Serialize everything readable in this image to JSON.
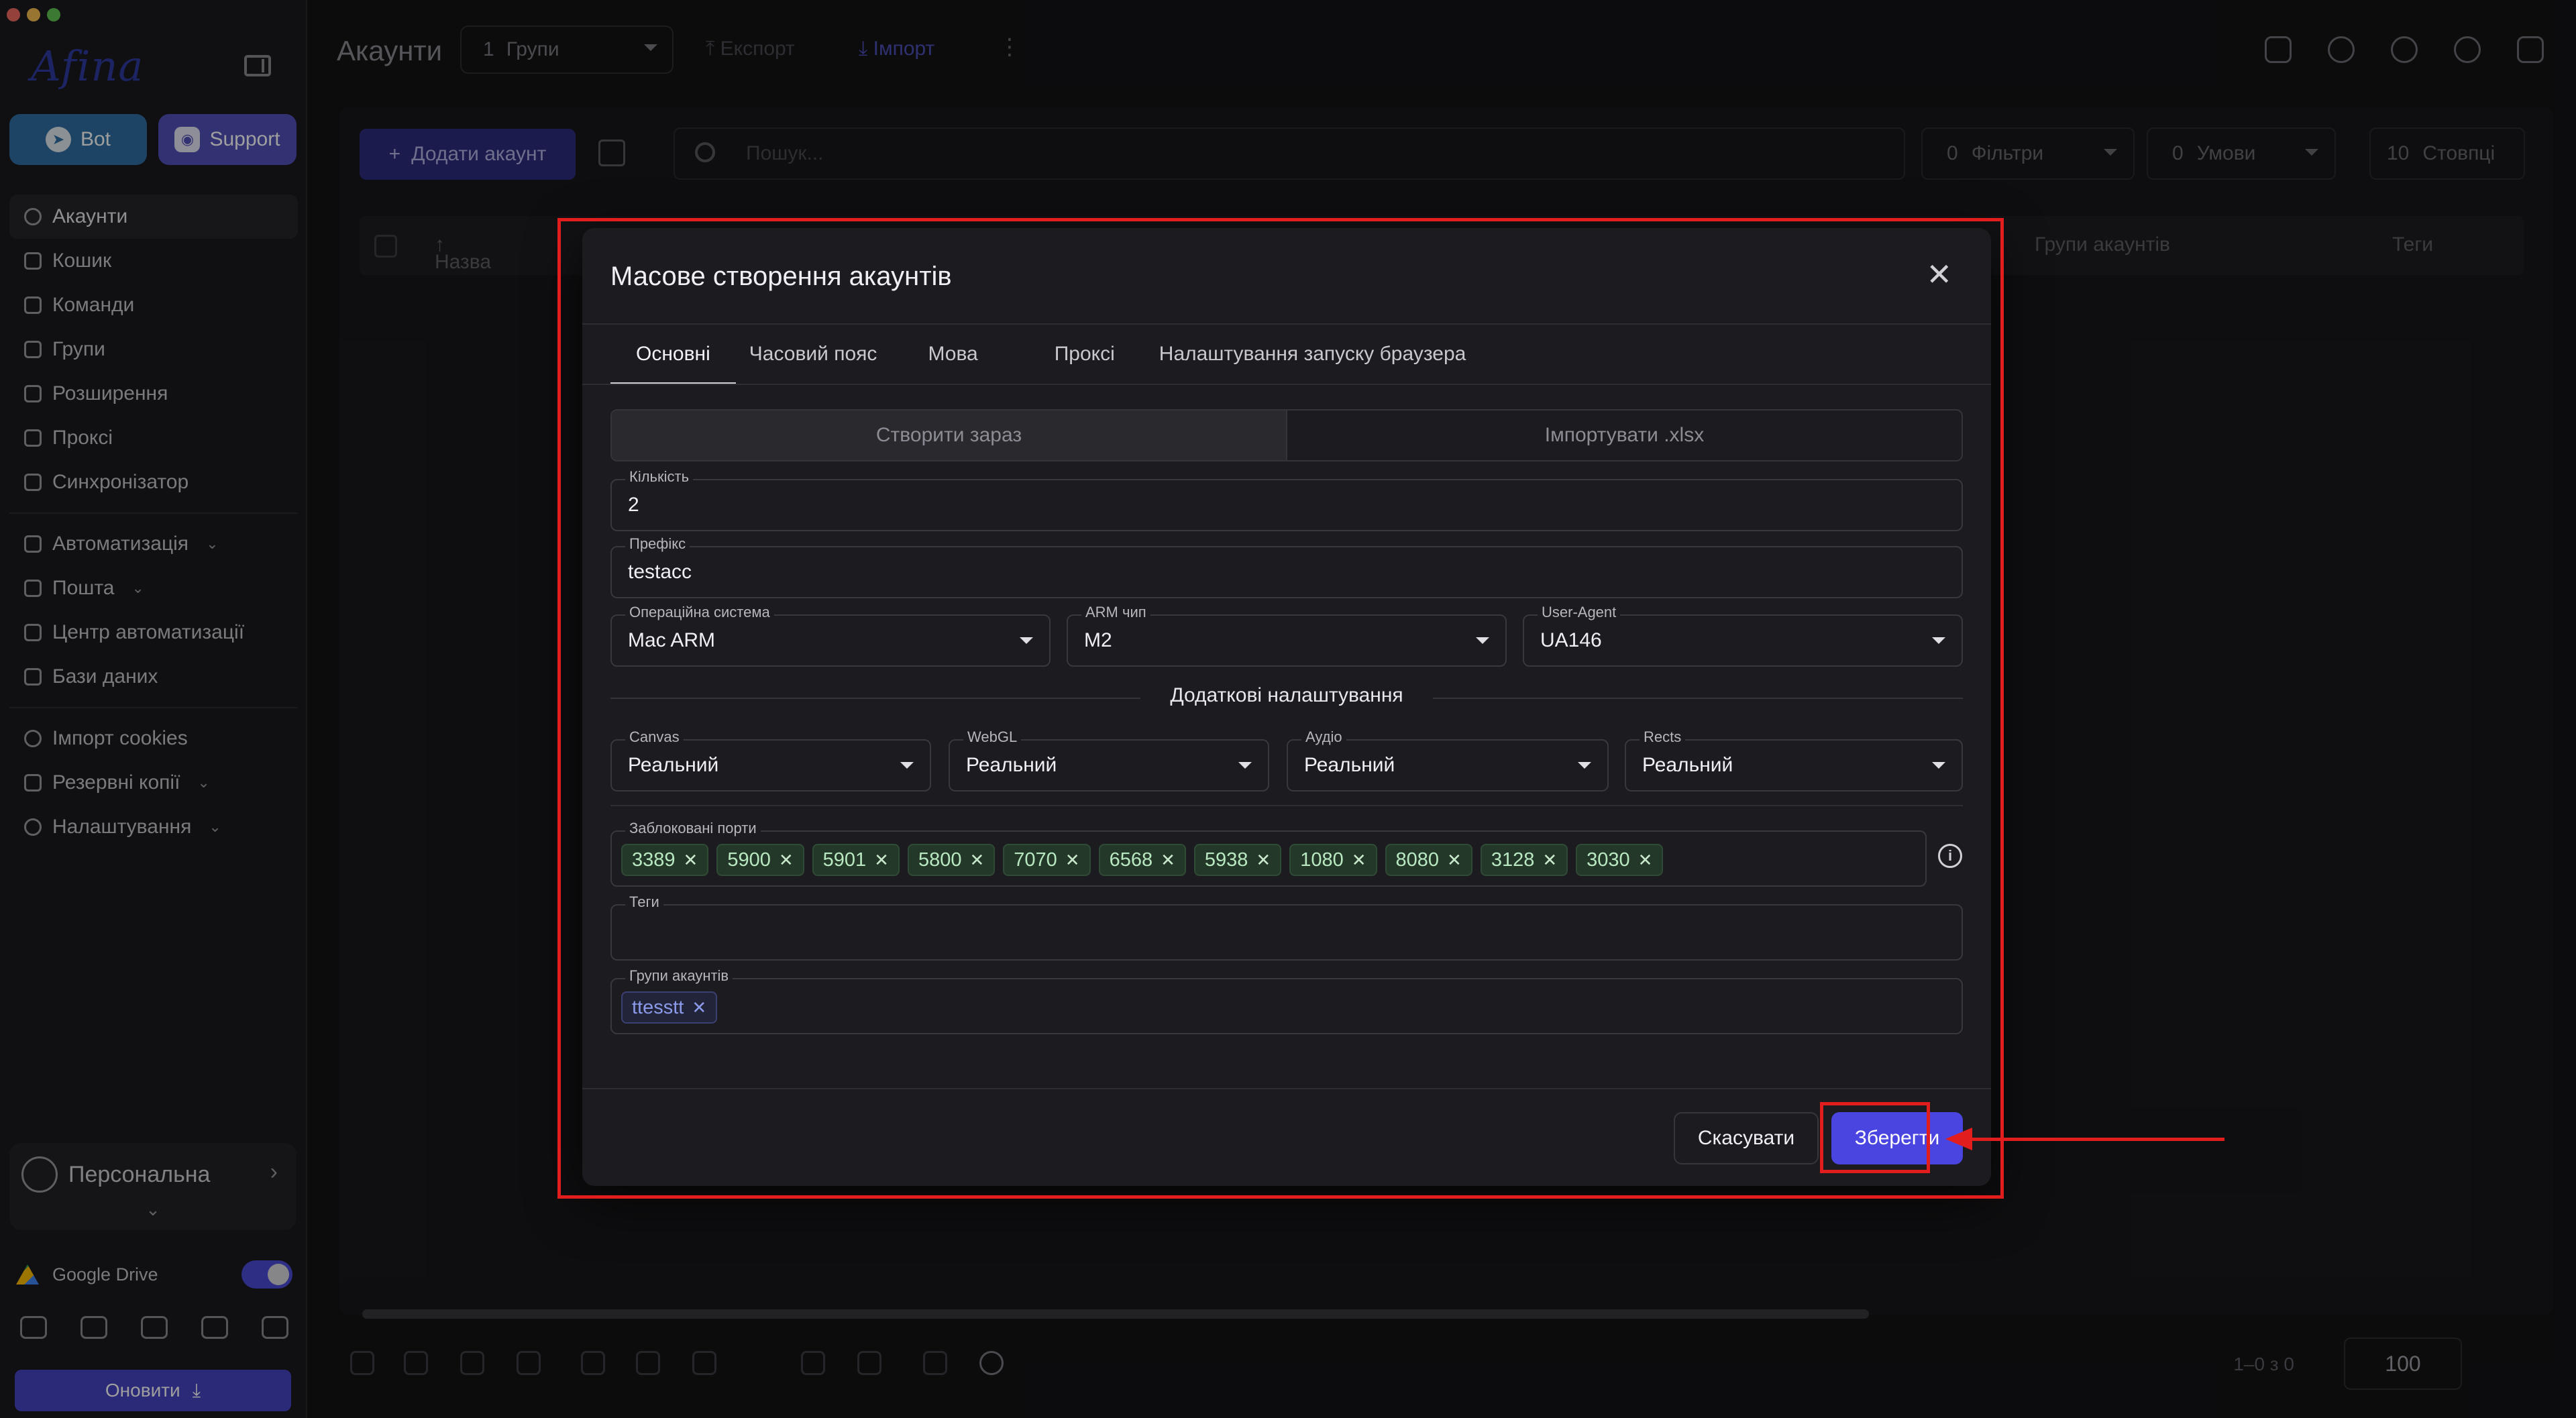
{
  "sidebar": {
    "logo": "Afina",
    "bot_label": "Bot",
    "support_label": "Support",
    "nav": [
      {
        "label": "Акаунти"
      },
      {
        "label": "Кошик"
      },
      {
        "label": "Команди"
      },
      {
        "label": "Групи"
      },
      {
        "label": "Розширення"
      },
      {
        "label": "Проксі"
      },
      {
        "label": "Синхронізатор"
      }
    ],
    "nav2": [
      {
        "label": "Автоматизація"
      },
      {
        "label": "Пошта"
      },
      {
        "label": "Центр автоматизації"
      },
      {
        "label": "Бази даних"
      }
    ],
    "nav3": [
      {
        "label": "Імпорт cookies"
      },
      {
        "label": "Резервні копії"
      },
      {
        "label": "Налаштування"
      }
    ],
    "profile_name": "Персональна",
    "gdrive_label": "Google Drive",
    "update_label": "Оновити"
  },
  "header": {
    "title": "Акаунти",
    "groups_count": "1",
    "groups_label": "Групи",
    "export_label": "Експорт",
    "import_label": "Імпорт"
  },
  "toolbar": {
    "add_account": "Додати акаунт",
    "search_placeholder": "Пошук...",
    "filters_count": "0",
    "filters_label": "Фільтри",
    "conditions_count": "0",
    "conditions_label": "Умови",
    "columns_count": "10",
    "columns_label": "Стовпці"
  },
  "table": {
    "col_name": "Назва",
    "col_groups": "Групи акаунтів",
    "col_tags": "Теги"
  },
  "pager": {
    "range": "1–0 з 0",
    "per_page": "100"
  },
  "modal": {
    "title": "Масове створення акаунтів",
    "tabs": [
      "Основні",
      "Часовий пояс",
      "Мова",
      "Проксі",
      "Налаштування запуску браузера"
    ],
    "seg_create": "Створити зараз",
    "seg_import": "Імпортувати .xlsx",
    "quantity_label": "Кількість",
    "quantity_value": "2",
    "prefix_label": "Префікс",
    "prefix_value": "testacc",
    "os_label": "Операційна система",
    "os_value": "Mac ARM",
    "arm_label": "ARM чип",
    "arm_value": "M2",
    "ua_label": "User-Agent",
    "ua_value": "UA146",
    "extra_title": "Додаткові налаштування",
    "canvas_label": "Canvas",
    "canvas_value": "Реальний",
    "webgl_label": "WebGL",
    "webgl_value": "Реальний",
    "audio_label": "Аудіо",
    "audio_value": "Реальний",
    "rects_label": "Rects",
    "rects_value": "Реальний",
    "ports_label": "Заблоковані порти",
    "ports": [
      "3389",
      "5900",
      "5901",
      "5800",
      "7070",
      "6568",
      "5938",
      "1080",
      "8080",
      "3128",
      "3030"
    ],
    "tags_label": "Теги",
    "groups_label": "Групи акаунтів",
    "groups": [
      "ttesstt"
    ],
    "cancel_label": "Скасувати",
    "save_label": "Зберегти"
  },
  "colors": {
    "accent": "#4a45e0",
    "annotation": "#e21d1d",
    "chip_bg": "#24382a",
    "chip_text": "#b8e8c0"
  }
}
